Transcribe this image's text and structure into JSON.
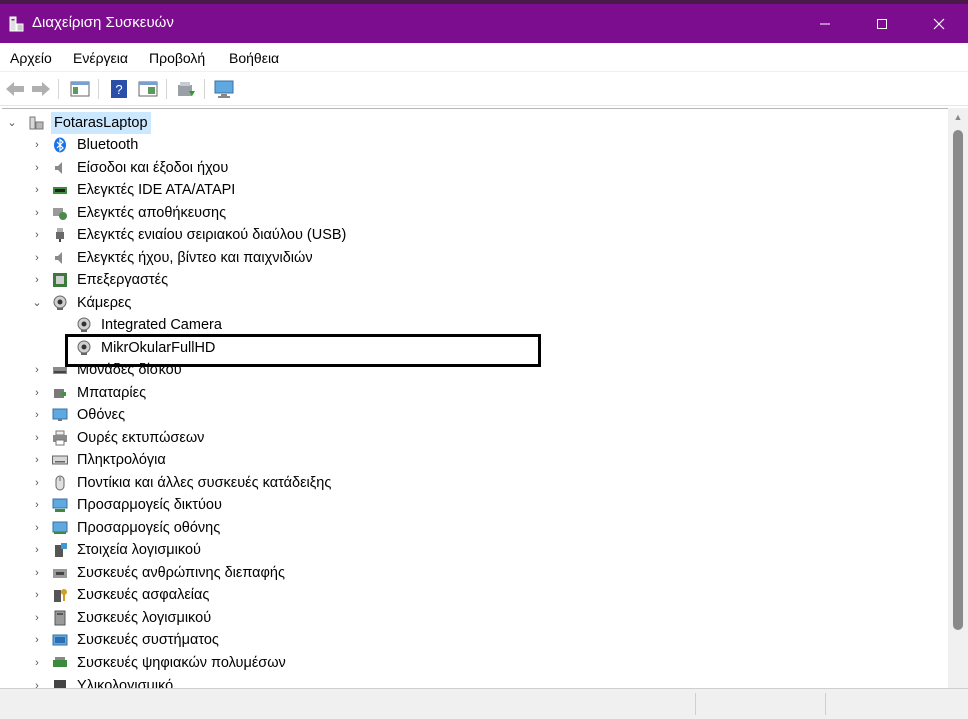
{
  "window": {
    "title": "Διαχείριση Συσκευών"
  },
  "menu": [
    "Αρχείο",
    "Ενέργεια",
    "Προβολή",
    "Βοήθεια"
  ],
  "tree": {
    "root": "FotarasLaptop",
    "categories": [
      "Bluetooth",
      "Είσοδοι και έξοδοι ήχου",
      "Ελεγκτές IDE ATA/ATAPI",
      "Ελεγκτές αποθήκευσης",
      "Ελεγκτές ενιαίου σειριακού διαύλου (USB)",
      "Ελεγκτές ήχου, βίντεο και παιχνιδιών",
      "Επεξεργαστές",
      "Κάμερες",
      "Μονάδες δίσκου",
      "Μπαταρίες",
      "Οθόνες",
      "Ουρές εκτυπώσεων",
      "Πληκτρολόγια",
      "Ποντίκια και άλλες συσκευές κατάδειξης",
      "Προσαρμογείς δικτύου",
      "Προσαρμογείς οθόνης",
      "Στοιχεία λογισμικού",
      "Συσκευές ανθρώπινης διεπαφής",
      "Συσκευές ασφαλείας",
      "Συσκευές λογισμικού",
      "Συσκευές συστήματος",
      "Συσκευές ψηφιακών πολυμέσων",
      "Υλικολογισμικό"
    ],
    "cameras": [
      "Integrated Camera",
      "MikrOkularFullHD"
    ]
  },
  "colors": {
    "titlebar": "#7b0d8e",
    "selection": "#cce8ff",
    "highlight_box": "#000000"
  }
}
